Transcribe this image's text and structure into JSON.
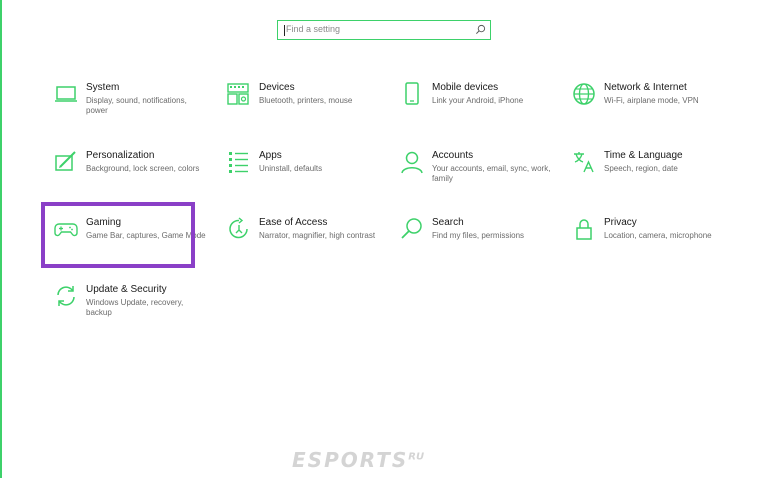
{
  "search": {
    "placeholder": "Find a setting"
  },
  "colors": {
    "accent": "#3dd16a",
    "highlight": "#8a3fc7"
  },
  "tiles": [
    {
      "icon": "laptop-icon",
      "title": "System",
      "desc": "Display, sound, notifications, power"
    },
    {
      "icon": "devices-icon",
      "title": "Devices",
      "desc": "Bluetooth, printers, mouse"
    },
    {
      "icon": "phone-icon",
      "title": "Mobile devices",
      "desc": "Link your Android, iPhone"
    },
    {
      "icon": "globe-icon",
      "title": "Network & Internet",
      "desc": "Wi-Fi, airplane mode, VPN"
    },
    {
      "icon": "paint-icon",
      "title": "Personalization",
      "desc": "Background, lock screen, colors"
    },
    {
      "icon": "apps-icon",
      "title": "Apps",
      "desc": "Uninstall, defaults"
    },
    {
      "icon": "person-icon",
      "title": "Accounts",
      "desc": "Your accounts, email, sync, work, family"
    },
    {
      "icon": "language-icon",
      "title": "Time & Language",
      "desc": "Speech, region, date"
    },
    {
      "icon": "gamepad-icon",
      "title": "Gaming",
      "desc": "Game Bar, captures, Game Mode"
    },
    {
      "icon": "ease-of-access-icon",
      "title": "Ease of Access",
      "desc": "Narrator, magnifier, high contrast"
    },
    {
      "icon": "search-icon",
      "title": "Search",
      "desc": "Find my files, permissions"
    },
    {
      "icon": "lock-icon",
      "title": "Privacy",
      "desc": "Location, camera, microphone"
    },
    {
      "icon": "update-icon",
      "title": "Update & Security",
      "desc": "Windows Update, recovery, backup"
    }
  ],
  "watermark": {
    "text": "ESPORTS",
    "suffix": "RU"
  }
}
